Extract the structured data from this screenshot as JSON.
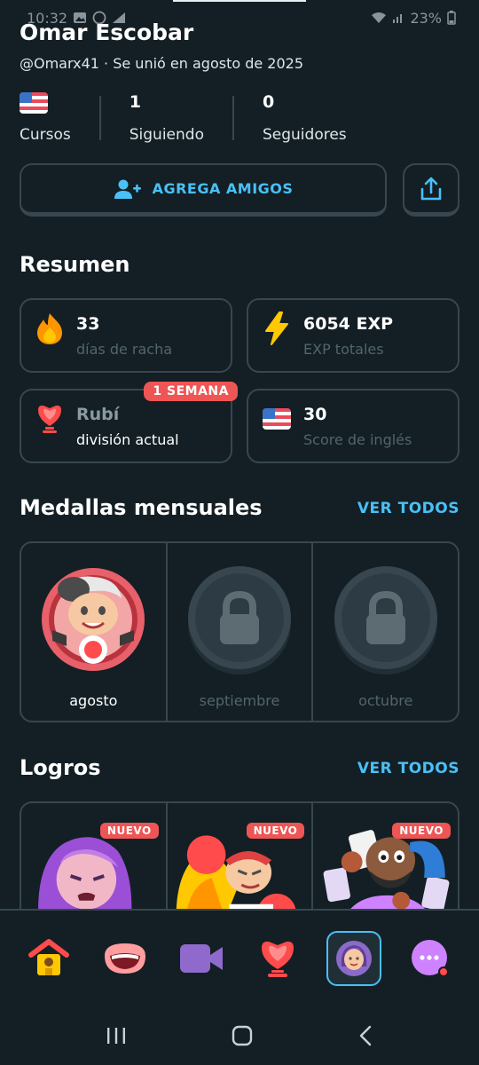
{
  "status_bar": {
    "time": "10:32",
    "battery": "23%"
  },
  "profile": {
    "name": "Omar Escobar",
    "handle": "@Omarx41 · Se unió en agosto de 2025"
  },
  "stats": {
    "courses_label": "Cursos",
    "following_value": "1",
    "following_label": "Siguiendo",
    "followers_value": "0",
    "followers_label": "Seguidores"
  },
  "actions": {
    "add_friends": "AGREGA AMIGOS"
  },
  "summary": {
    "title": "Resumen",
    "streak_value": "33",
    "streak_label": "días de racha",
    "xp_value": "6054 EXP",
    "xp_label": "EXP totales",
    "league_value": "Rubí",
    "league_label": "división actual",
    "league_badge": "1 SEMANA",
    "score_value": "30",
    "score_label": "Score de inglés"
  },
  "medals": {
    "title": "Medallas mensuales",
    "see_all": "VER TODOS",
    "items": [
      {
        "label": "agosto",
        "locked": false
      },
      {
        "label": "septiembre",
        "locked": true
      },
      {
        "label": "octubre",
        "locked": true
      }
    ]
  },
  "achievements": {
    "title": "Logros",
    "see_all": "VER TODOS",
    "badge": "NUEVO"
  },
  "bottom_nav": {
    "items": [
      "home-icon",
      "speaking-icon",
      "video-icon",
      "leagues-icon",
      "profile-icon",
      "more-icon"
    ],
    "active": "profile-icon"
  },
  "colors": {
    "background": "#131f24",
    "border": "#37464f",
    "accent": "#49c0f8",
    "badge": "#ee5555",
    "muted": "#52656d"
  }
}
